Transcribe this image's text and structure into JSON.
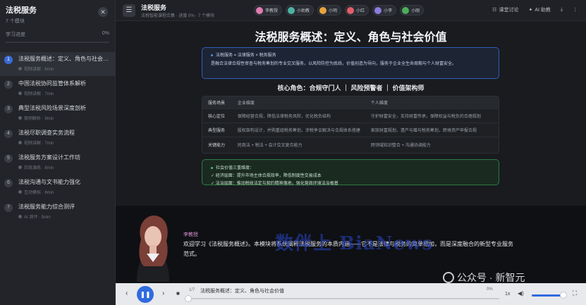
{
  "sidebar": {
    "title": "法税服务",
    "subtitle": "7 个模块",
    "progress_label": "学习进度",
    "progress_value": "0%",
    "progress_fraction": 0,
    "items": [
      {
        "num": "1",
        "label": "法税服务概述：定义、角色与社会价值",
        "meta": "视频讲解 · 6min"
      },
      {
        "num": "2",
        "label": "中国法税协同监管体系解析",
        "meta": "视频讲解 · 7min"
      },
      {
        "num": "3",
        "label": "典型法税风险场景深度剖析",
        "meta": "案例解析 · 9min"
      },
      {
        "num": "4",
        "label": "法税尽职调查实务流程",
        "meta": "视频讲解 · 7min"
      },
      {
        "num": "5",
        "label": "法税服务方案设计工作坊",
        "meta": "实践演练 · 8min"
      },
      {
        "num": "6",
        "label": "法税沟通与文书能力强化",
        "meta": "互动模拟 · 6min"
      },
      {
        "num": "7",
        "label": "法税服务能力综合测评",
        "meta": "AI 测评 · 5min"
      }
    ]
  },
  "topbar": {
    "title": "法税服务",
    "subtitle": "法税智能课程合集 · 进度 0% · 7 个模块",
    "roles": [
      {
        "label": "李教授",
        "color": "#e07bb0"
      },
      {
        "label": "小助教",
        "color": "#4ab3a3"
      },
      {
        "label": "小明",
        "color": "#e8a23c"
      },
      {
        "label": "小红",
        "color": "#e35d6a"
      },
      {
        "label": "小李",
        "color": "#8c7be0"
      },
      {
        "label": "小刚",
        "color": "#4cae5a"
      }
    ],
    "actions": {
      "discuss": "课堂讨论",
      "ai": "AI 助教"
    }
  },
  "slide": {
    "title": "法税服务概述：定义、角色与社会价值",
    "blue_box": {
      "line1": "法税服务 = 法律服务 × 税务服务",
      "line2": "是融合法律合规性审查与税务筹划的专业交叉服务，以风险防控为底线，价值创造为导向，服务于企业全生命周期与个人财富安全。"
    },
    "core_roles": "核心角色：合规守门人 ｜ 风险预警者 ｜ 价值架构师",
    "table": {
      "headers": [
        "服务场景",
        "企业维度",
        "个人维度"
      ],
      "rows": [
        [
          "核心定位",
          "保障经营合规，降低法律税务风险，优化税负结构",
          "守护财富安全，支持财富传承，保障权益与税负的合理规划"
        ],
        [
          "典型服务",
          "股权架构设计，并购重组税务筹划，涉税争议解决与合规体系搭建",
          "家族财富规划，遗产与赠与税务筹划，跨境资产申报合规"
        ],
        [
          "关键能力",
          "民商法 + 税法 + 会计交叉复合能力",
          "跨领域知识整合 + 沟通协调能力"
        ]
      ]
    },
    "green_box": {
      "title": "社会价值三重维度：",
      "line1": "✓ 经济层面：提升市场主体合规效率，降低制度性交易成本",
      "line2": "✓ 法治层面：推动税收法定与契约精神落地，强化营商环境法治根基"
    }
  },
  "narration": {
    "speaker": "李教授",
    "text": "欢迎学习《法税服务概述》。本模块将系统阐释法税服务的本质内涵——它不是法律与税务的简单相加，而是深度融合的新型专业服务范式。",
    "watermark": "数伴上 BiaNews"
  },
  "controls": {
    "counter": "1/7",
    "title": "法税服务概述：定义、角色与社会价值",
    "percent": "0%",
    "speed": "1x",
    "volume_fraction": 0.9
  },
  "overlay": {
    "wechat": "公众号 · 新智元"
  }
}
